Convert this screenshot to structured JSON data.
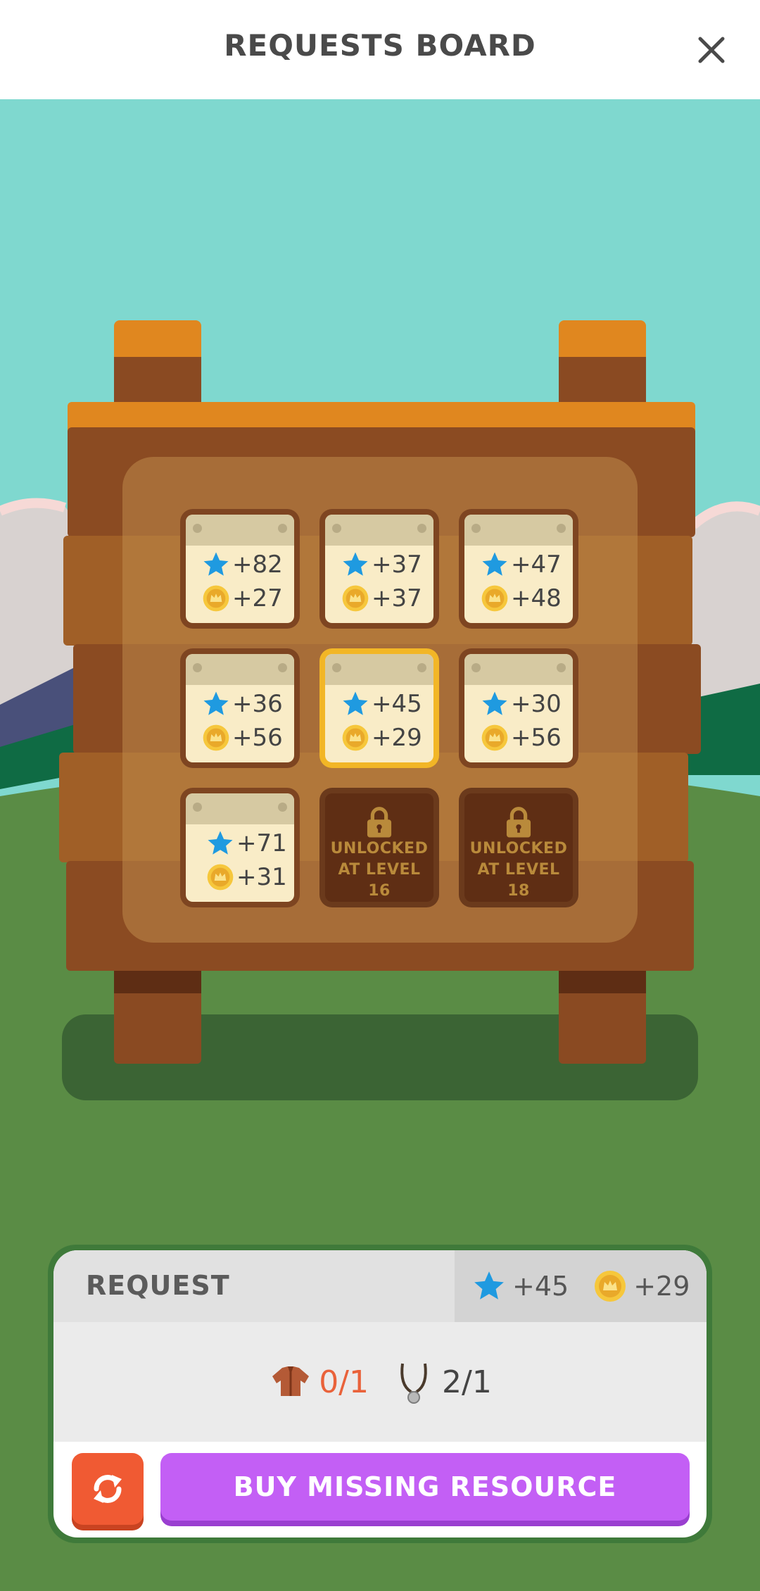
{
  "header": {
    "title": "REQUESTS BOARD",
    "close_icon": "close-icon"
  },
  "board": {
    "tiles": [
      {
        "stars": "+82",
        "coins": "+27",
        "selected": false,
        "locked": false
      },
      {
        "stars": "+37",
        "coins": "+37",
        "selected": false,
        "locked": false
      },
      {
        "stars": "+47",
        "coins": "+48",
        "selected": false,
        "locked": false
      },
      {
        "stars": "+36",
        "coins": "+56",
        "selected": false,
        "locked": false
      },
      {
        "stars": "+45",
        "coins": "+29",
        "selected": true,
        "locked": false
      },
      {
        "stars": "+30",
        "coins": "+56",
        "selected": false,
        "locked": false
      },
      {
        "stars": "+71",
        "coins": "+31",
        "selected": false,
        "locked": false
      },
      {
        "locked": true,
        "lock_line1": "UNLOCKED",
        "lock_line2": "AT LEVEL 16"
      },
      {
        "locked": true,
        "lock_line1": "UNLOCKED",
        "lock_line2": "AT LEVEL 18"
      }
    ]
  },
  "request": {
    "label": "REQUEST",
    "reward_stars": "+45",
    "reward_coins": "+29",
    "resources": [
      {
        "icon": "leather-jacket-icon",
        "count": "0/1",
        "status": "missing"
      },
      {
        "icon": "necklace-icon",
        "count": "2/1",
        "status": "ok"
      }
    ]
  },
  "actions": {
    "refresh_icon": "refresh-icon",
    "buy_label": "BUY MISSING RESOURCE"
  },
  "colors": {
    "accent_purple": "#c35ff5",
    "refresh_orange": "#f05a33",
    "selected_gold": "#f2b626",
    "missing_red": "#e9623a"
  }
}
